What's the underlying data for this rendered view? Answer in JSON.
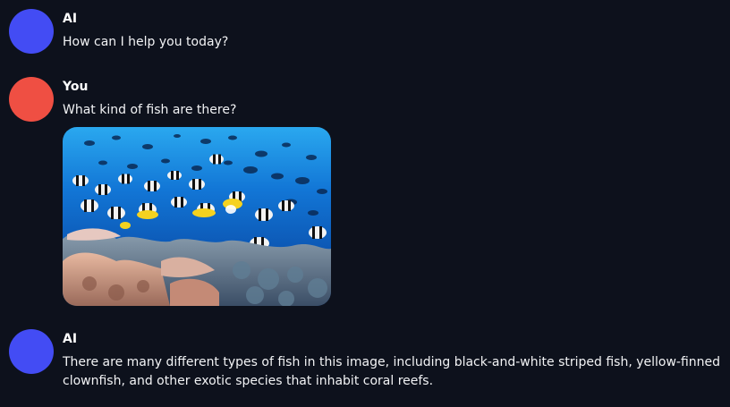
{
  "colors": {
    "background": "#0d111c",
    "ai_avatar": "#434cf4",
    "user_avatar": "#ef4f43"
  },
  "messages": [
    {
      "author": "AI",
      "avatar_color": "#434cf4",
      "text": "How can I help you today?"
    },
    {
      "author": "You",
      "avatar_color": "#ef4f43",
      "text": "What kind of fish are there?",
      "attachment": {
        "type": "image",
        "subject": "coral reef with schools of striped and yellow fish"
      }
    },
    {
      "author": "AI",
      "avatar_color": "#434cf4",
      "text": "There are many different types of fish in this image, including black-and-white striped fish, yellow-finned clownfish, and other exotic species that inhabit coral reefs."
    }
  ]
}
